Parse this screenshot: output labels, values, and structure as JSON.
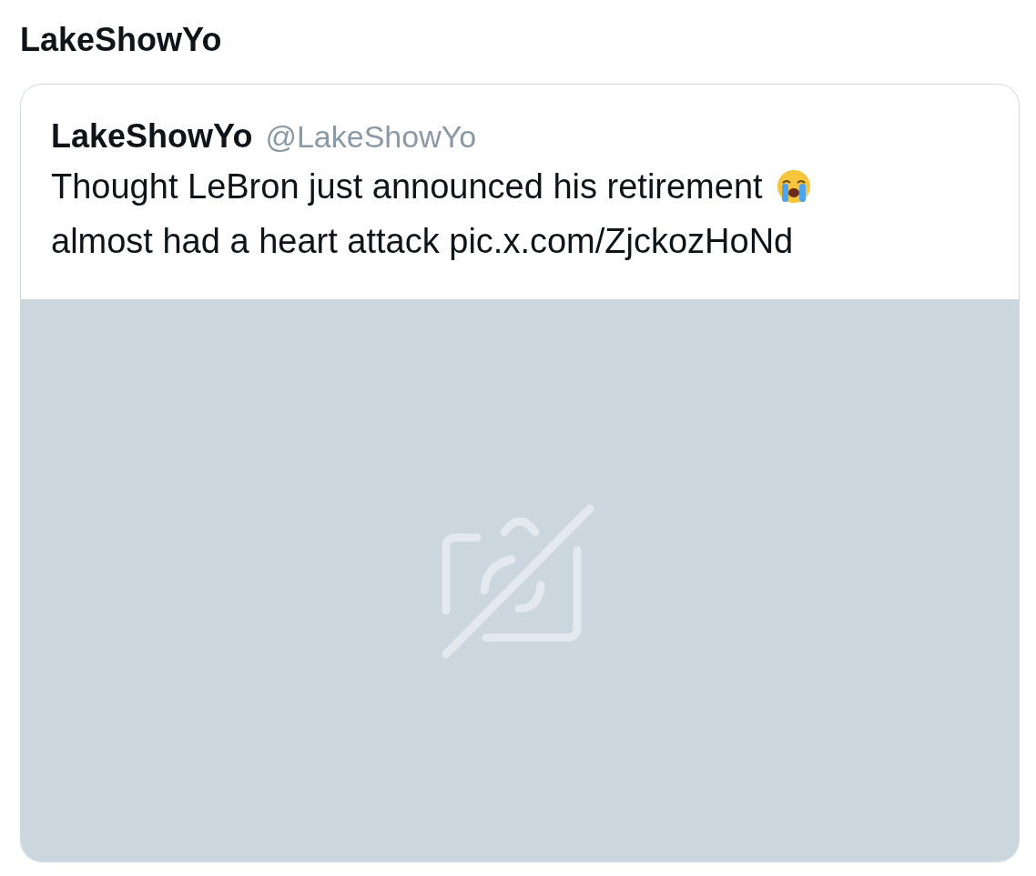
{
  "title": "LakeShowYo",
  "quoted_post": {
    "author_name": "LakeShowYo",
    "handle": "@LakeShowYo",
    "text_before_emoji": "Thought LeBron just announced his retirement",
    "text_after_emoji": "almost had a heart attack pic.x.com/ZjckozHoNd",
    "media": {
      "kind": "unavailable"
    }
  }
}
